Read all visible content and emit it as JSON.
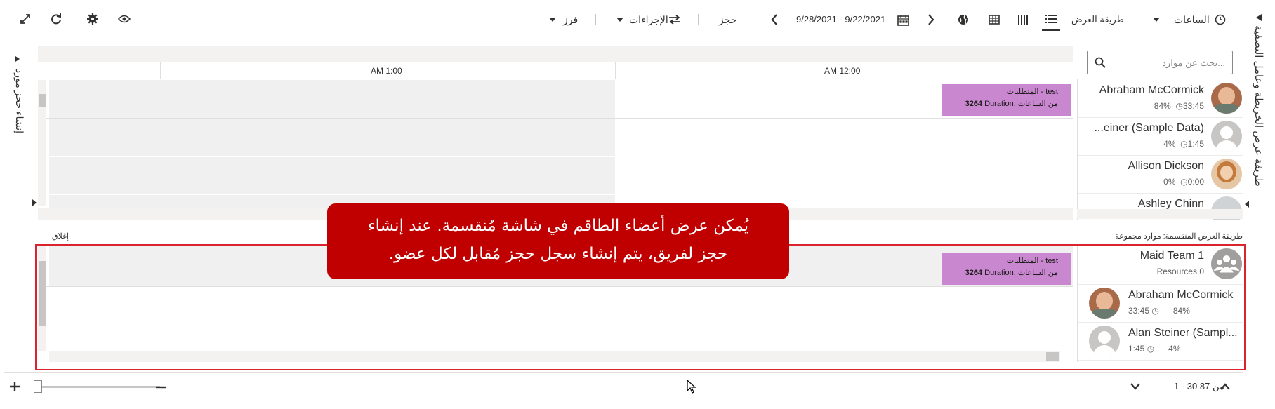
{
  "toolbar": {
    "hours_label": "الساعات",
    "view_mode_label": "طريقة العرض",
    "date_range": "9/28/2021 - 9/22/2021",
    "book_label": "حجز",
    "actions_label": "الإجراءات",
    "sort_label": "فرز"
  },
  "right_pane": {
    "label": "طريقة عرض الخريطة وعامل التصفية"
  },
  "left_pane": {
    "label": "إنشاء حجز مورد"
  },
  "search": {
    "placeholder": "بحث عن موارد..."
  },
  "timeline": {
    "col1": "AM 12:00",
    "col2": "AM 1:00"
  },
  "requirement": {
    "line1": "المتطلبات - test",
    "line2_bold": "3264",
    "line2_text": "Duration: من الساعات"
  },
  "resources_top": [
    {
      "name": "Abraham McCormick",
      "hours": "33:45",
      "pct": "84%"
    },
    {
      "name": "...einer (Sample Data)",
      "hours": "1:45",
      "pct": "4%"
    },
    {
      "name": "Allison Dickson",
      "hours": "0:00",
      "pct": "0%"
    },
    {
      "name": "Ashley Chinn",
      "hours": "",
      "pct": ""
    }
  ],
  "split_view": {
    "label": "طريقة العرض المنقسمة: موارد مجموعة",
    "close_label": "إغلاق"
  },
  "team": {
    "name": "Maid Team 1",
    "resources": "Resources 0"
  },
  "resources_bottom": [
    {
      "name": "Abraham McCormick",
      "hours": "33:45",
      "pct": "84%"
    },
    {
      "name": "Alan Steiner (Sampl...",
      "hours": "1:45",
      "pct": "4%"
    }
  ],
  "callout": {
    "line1": "يُمكن عرض أعضاء الطاقم في شاشة مُنقسمة. عند إنشاء",
    "line2": "حجز لفريق، يتم إنشاء سجل حجز مُقابل لكل عضو."
  },
  "footer": {
    "pagination": "1 - 30 من 87"
  },
  "colors": {
    "requirement": "#c987d0",
    "callout": "#c00000",
    "highlight": "#d9232d"
  }
}
